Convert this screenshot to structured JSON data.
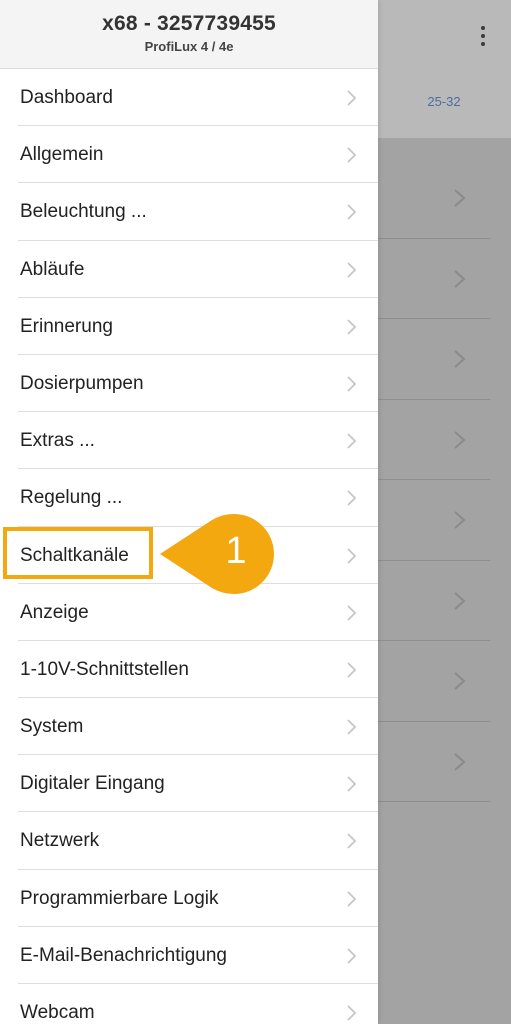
{
  "drawer": {
    "title": "x68 - 3257739455",
    "subtitle": "ProfiLux 4 / 4e",
    "items": [
      {
        "label": "Dashboard"
      },
      {
        "label": "Allgemein"
      },
      {
        "label": "Beleuchtung ..."
      },
      {
        "label": "Abläufe"
      },
      {
        "label": "Erinnerung"
      },
      {
        "label": "Dosierpumpen"
      },
      {
        "label": "Extras ..."
      },
      {
        "label": "Regelung ..."
      },
      {
        "label": "Schaltkanäle"
      },
      {
        "label": "Anzeige"
      },
      {
        "label": "1-10V-Schnittstellen"
      },
      {
        "label": "System"
      },
      {
        "label": "Digitaler Eingang"
      },
      {
        "label": "Netzwerk"
      },
      {
        "label": "Programmierbare Logik"
      },
      {
        "label": "E-Mail-Benachrichtigung"
      },
      {
        "label": "Webcam"
      }
    ],
    "chevron_icon": "chevron-right-icon"
  },
  "background": {
    "tab_label": "25-32",
    "menu_icon": "more-vert-icon",
    "row_count": 8
  },
  "annotation": {
    "number": "1",
    "highlighted_item": "Schaltkanäle",
    "color": "#f3a80f"
  },
  "colors": {
    "overlay": "#a3a3a3",
    "accent": "#f3a80f",
    "tab_text": "#4d6da0"
  }
}
